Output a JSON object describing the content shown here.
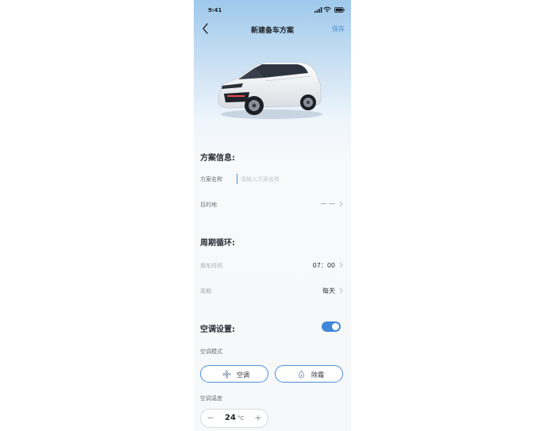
{
  "status_bar": {
    "time": "9:41"
  },
  "nav": {
    "title": "新建备车方案",
    "save_label": "保存"
  },
  "plan_info": {
    "section_title": "方案信息:",
    "name_label": "方案名称",
    "name_value": "",
    "name_placeholder": "请输入方案名称",
    "destination_label": "目的地",
    "destination_value": "— —"
  },
  "cycle": {
    "section_title": "周期循环:",
    "time_label": "用车时间",
    "time_value": "07：00",
    "period_label": "周期",
    "period_value": "每天"
  },
  "ac": {
    "section_title": "空调设置:",
    "enabled": true,
    "mode_label": "空调模式",
    "modes": [
      {
        "label": "空调",
        "icon": "fan-icon"
      },
      {
        "label": "除霜",
        "icon": "defrost-icon"
      }
    ],
    "temp_label": "空调温度",
    "temp_value": "24",
    "temp_unit": "°C",
    "minus": "−",
    "plus": "+"
  },
  "colors": {
    "accent": "#4a8fdc",
    "toggle_on": "#3f87d8",
    "text": "#2b2f36",
    "muted": "#a7abb2"
  }
}
